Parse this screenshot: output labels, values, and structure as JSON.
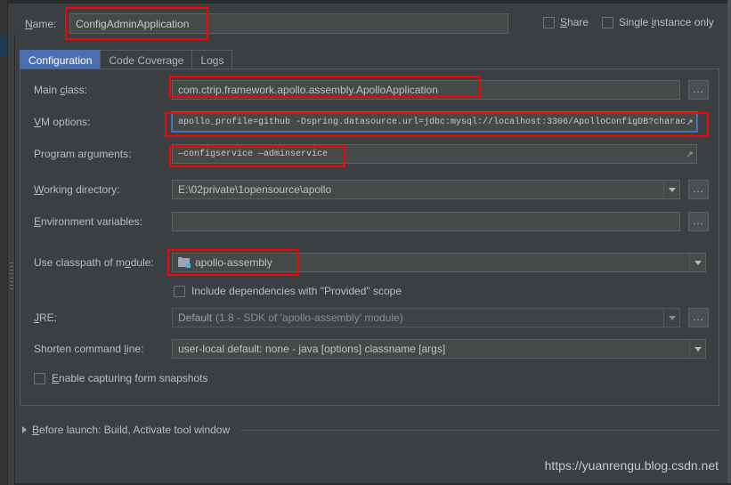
{
  "dialog": {
    "name_label": "Name:",
    "name_value": "ConfigAdminApplication",
    "share_label": "Share",
    "single_instance_label": "Single instance only"
  },
  "tabs": [
    {
      "label": "Configuration",
      "active": true
    },
    {
      "label": "Code Coverage",
      "active": false
    },
    {
      "label": "Logs",
      "active": false
    }
  ],
  "fields": {
    "main_class": {
      "label": "Main class:",
      "value": "com.ctrip.framework.apollo.assembly.ApolloApplication",
      "browse": "..."
    },
    "vm_options": {
      "label": "VM options:",
      "value": "apollo_profile=github -Dspring.datasource.url=jdbc:mysql://localhost:3306/ApolloConfigDB?charac",
      "expand_icon": "expand-arrow-icon"
    },
    "program_arguments": {
      "label": "Program arguments:",
      "value": "—configservice —adminservice",
      "expand_icon": "expand-arrow-icon"
    },
    "working_directory": {
      "label": "Working directory:",
      "value": "E:\\02private\\1opensource\\apollo",
      "browse": "..."
    },
    "environment_variables": {
      "label": "Environment variables:",
      "value": "",
      "browse": "..."
    },
    "use_classpath": {
      "label": "Use classpath of module:",
      "value": "apollo-assembly",
      "icon": "module-icon"
    },
    "include_provided": {
      "label": "Include dependencies with \"Provided\" scope",
      "checked": false
    },
    "jre": {
      "label": "JRE:",
      "value_main": "Default",
      "value_dim": "(1.8 - SDK of 'apollo-assembly' module)",
      "browse": "..."
    },
    "shorten_command_line": {
      "label": "Shorten command line:",
      "value": "user-local default: none - java [options] classname [args]"
    },
    "enable_capturing": {
      "label": "Enable capturing form snapshots",
      "checked": false
    }
  },
  "before_launch": {
    "text": "Before launch: Build, Activate tool window"
  },
  "watermark": {
    "text": "https://yuanrengu.blog.csdn.net"
  },
  "colors": {
    "background": "#3c3f41",
    "field_background": "#45494a",
    "accent_tab": "#4b6eaf",
    "annotation": "#ff0000",
    "module_icon_accent": "#40b6e0"
  }
}
